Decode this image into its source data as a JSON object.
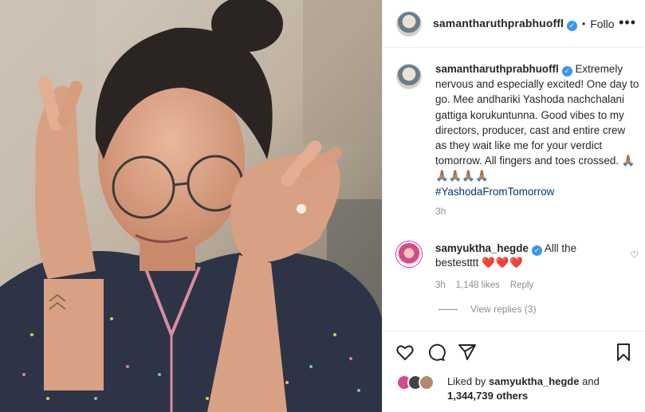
{
  "post": {
    "username": "samantharuthprabhuoffl",
    "verified_mark": "✓",
    "dot": "•",
    "follow_label": "Follo",
    "more_icon": "•••",
    "caption": "Extremely nervous and especially excited! One day to go. Mee andhariki Yashoda nachchalani gattiga korukuntunna. Good vibes to my directors, producer, cast and entire crew as they wait like me for your verdict tomorrow. All fingers and toes crossed. 🙏🏽🙏🏽🙏🏽🙏🏽🙏🏽",
    "hashtag": "#YashodaFromTomorrow",
    "time": "3h"
  },
  "comment": {
    "username": "samyuktha_hegde",
    "text": "Alll the bestestttt",
    "hearts": "❤️❤️❤️",
    "time": "3h",
    "likes": "1,148 likes",
    "reply_label": "Reply",
    "view_replies": "View replies (3)"
  },
  "likes": {
    "prefix": "Liked by",
    "user": "samyuktha_hegde",
    "and": "and",
    "others": "1,344,739 others"
  },
  "icons": [
    "heart-icon",
    "comment-icon",
    "share-icon",
    "bookmark-icon",
    "more-options-icon",
    "verified-icon"
  ],
  "colors": {
    "link": "#00376b",
    "secondary": "#8e8e8e",
    "verified": "#3897f0",
    "heart": "#ed4956"
  }
}
